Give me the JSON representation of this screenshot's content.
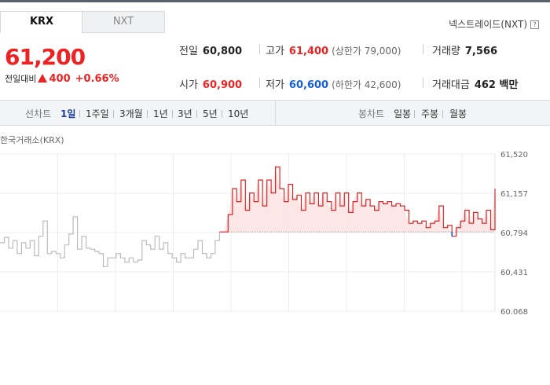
{
  "tabs": [
    {
      "label": "KRX",
      "active": true
    },
    {
      "label": "NXT",
      "active": false
    }
  ],
  "nxt_link": {
    "label": "넥스트레이드(NXT)",
    "help_glyph": "?"
  },
  "price": {
    "current": "61,200",
    "change_label": "전일대비",
    "change_amount": "400",
    "change_percent": "+0.66%",
    "direction": "up"
  },
  "stats": {
    "prev_close": {
      "label": "전일",
      "value": "60,800"
    },
    "high": {
      "label": "고가",
      "value": "61,400",
      "sub": "(상한가 79,000)"
    },
    "volume": {
      "label": "거래량",
      "value": "7,566"
    },
    "open": {
      "label": "시가",
      "value": "60,900"
    },
    "low": {
      "label": "저가",
      "value": "60,600",
      "sub": "(하한가 42,600)"
    },
    "turnover": {
      "label": "거래대금",
      "value": "462 백만"
    }
  },
  "toolbar": {
    "line_label": "선차트",
    "line_periods": [
      "1일",
      "1주일",
      "3개월",
      "1년",
      "3년",
      "5년",
      "10년"
    ],
    "active_period": "1일",
    "candle_label": "봉차트",
    "candle_periods": [
      "일봉",
      "주봉",
      "월봉"
    ]
  },
  "market_label": "한국거래소(KRX)",
  "colors": {
    "up": "#e22222",
    "down": "#1560d8",
    "prev_day": "#bbbbbb",
    "fill": "#fde3e3"
  },
  "chart_data": {
    "type": "line",
    "ylim": [
      60068,
      61520
    ],
    "yticks": [
      "61,520",
      "61,157",
      "60,794",
      "60,431",
      "60,068"
    ],
    "baseline": 60800,
    "series": [
      {
        "values": [
          60700,
          60750,
          60650,
          60720,
          60600,
          60700,
          60650,
          60720,
          60580,
          60760,
          60900,
          60600,
          60620,
          60600,
          60560,
          60680,
          60780,
          60940,
          60640,
          60760,
          60650,
          60640,
          60620,
          60600,
          60480,
          60560,
          60560,
          60600,
          60560,
          60520,
          60560,
          60520,
          60540,
          60720,
          60680,
          60640,
          60760,
          60640,
          60700,
          60600,
          60560,
          60520,
          60600,
          60560,
          60560,
          60640,
          60720,
          60600,
          60560,
          60600,
          60720,
          60800,
          60800,
          60960,
          61200,
          61080,
          61280,
          61000,
          61160,
          61080,
          61280,
          61040,
          61280,
          61160,
          61400,
          61200,
          61080,
          61240,
          61100,
          61140,
          61000,
          61160,
          61060,
          61160,
          61040,
          61160,
          61080,
          61000,
          61160,
          61040,
          61160,
          60980,
          61080,
          61160,
          61040,
          61100,
          61040,
          61000,
          61080,
          61060,
          61080,
          61040,
          61060,
          61040,
          61000,
          60880,
          60900,
          60880,
          60900,
          60840,
          60880,
          60900,
          61040,
          60840,
          60860,
          60760,
          60840,
          60900,
          61000,
          60880,
          60980,
          60920,
          60880,
          61000,
          60820,
          61200
        ]
      }
    ]
  }
}
